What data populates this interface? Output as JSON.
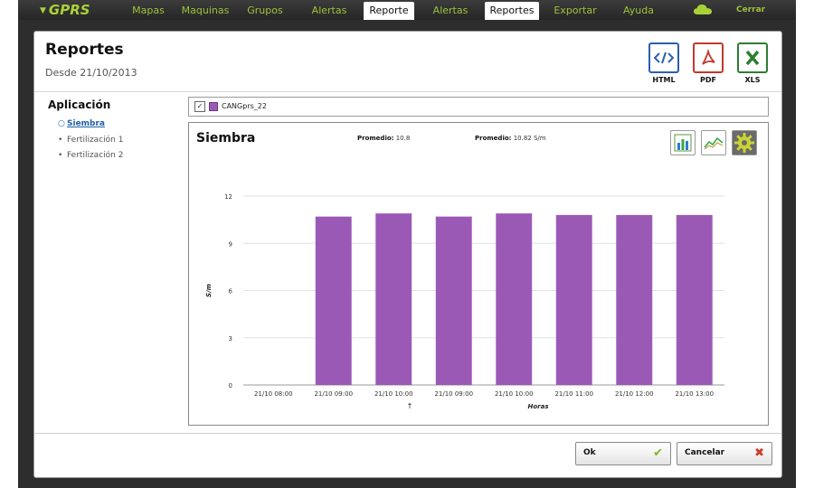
{
  "app": {
    "logo": "GPRS",
    "nav": [
      "Mapas",
      "Maquinas",
      "Grupos",
      "Alertas",
      "Reporte",
      "Alertas",
      "Reportes",
      "Exportar",
      "Ayuda"
    ],
    "logout": "Cerrar Sesión"
  },
  "modal": {
    "title": "Reportes",
    "subtitle": "Desde 21/10/2013",
    "export": {
      "html": "HTML",
      "pdf": "PDF",
      "xls": "XLS"
    }
  },
  "sidebar": {
    "title": "Aplicación",
    "items": [
      "Siembra",
      "Fertilización 1",
      "Fertilización 2"
    ]
  },
  "filter": {
    "chip": "CANGprs_22",
    "check": "✓"
  },
  "chart_panel": {
    "title": "Siembra",
    "promedio1_label": "Promedio:",
    "promedio1_value": "10.8",
    "promedio2_label": "Promedio:",
    "promedio2_value": "10.82 S/m"
  },
  "chart_data": {
    "type": "bar",
    "categories": [
      "21/10 08:00",
      "21/10 09:00",
      "21/10 10:00",
      "21/10 09:00",
      "21/10 10:00",
      "21/10 11:00",
      "21/10 12:00",
      "21/10 13:00"
    ],
    "values": [
      0,
      10.7,
      10.9,
      10.7,
      10.9,
      10.8,
      10.8,
      10.8
    ],
    "ylabel": "S/m",
    "xlabel": "Horas",
    "x_marker": "↑",
    "yticks": [
      0,
      3,
      6,
      9,
      12
    ],
    "ylim": [
      0,
      12
    ],
    "grid": true,
    "color": "#9b59b6"
  },
  "footer": {
    "ok": "Ok",
    "cancel": "Cancelar"
  },
  "colors": {
    "accent": "#a8d136",
    "bar": "#9b59b6",
    "link": "#1d5fa8"
  }
}
